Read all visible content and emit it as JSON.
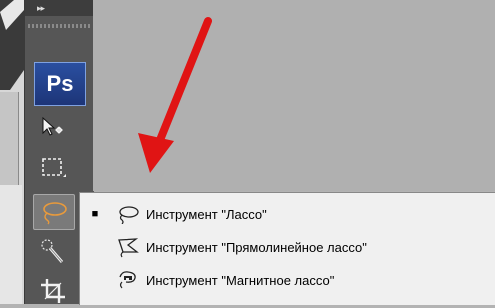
{
  "app": {
    "logo_text": "Ps",
    "collapse_glyph": "▸▸"
  },
  "toolbar": {
    "tools": [
      {
        "name": "move-tool-icon"
      },
      {
        "name": "marquee-tool-icon"
      },
      {
        "name": "lasso-tool-icon",
        "active": true
      },
      {
        "name": "quick-selection-tool-icon"
      },
      {
        "name": "crop-tool-icon"
      }
    ]
  },
  "menu": {
    "items": [
      {
        "label": "Инструмент \"Лассо\"",
        "checked": true,
        "icon": "lasso-icon"
      },
      {
        "label": "Инструмент \"Прямолинейное лассо\"",
        "checked": false,
        "icon": "polygonal-lasso-icon"
      },
      {
        "label": "Инструмент \"Магнитное лассо\"",
        "checked": false,
        "icon": "magnetic-lasso-icon"
      }
    ],
    "checked_mark": "■"
  },
  "colors": {
    "arrow": "#e01414",
    "toolbar": "#565656",
    "canvas": "#b0b0b0",
    "menu_bg": "#f0f0f0"
  }
}
